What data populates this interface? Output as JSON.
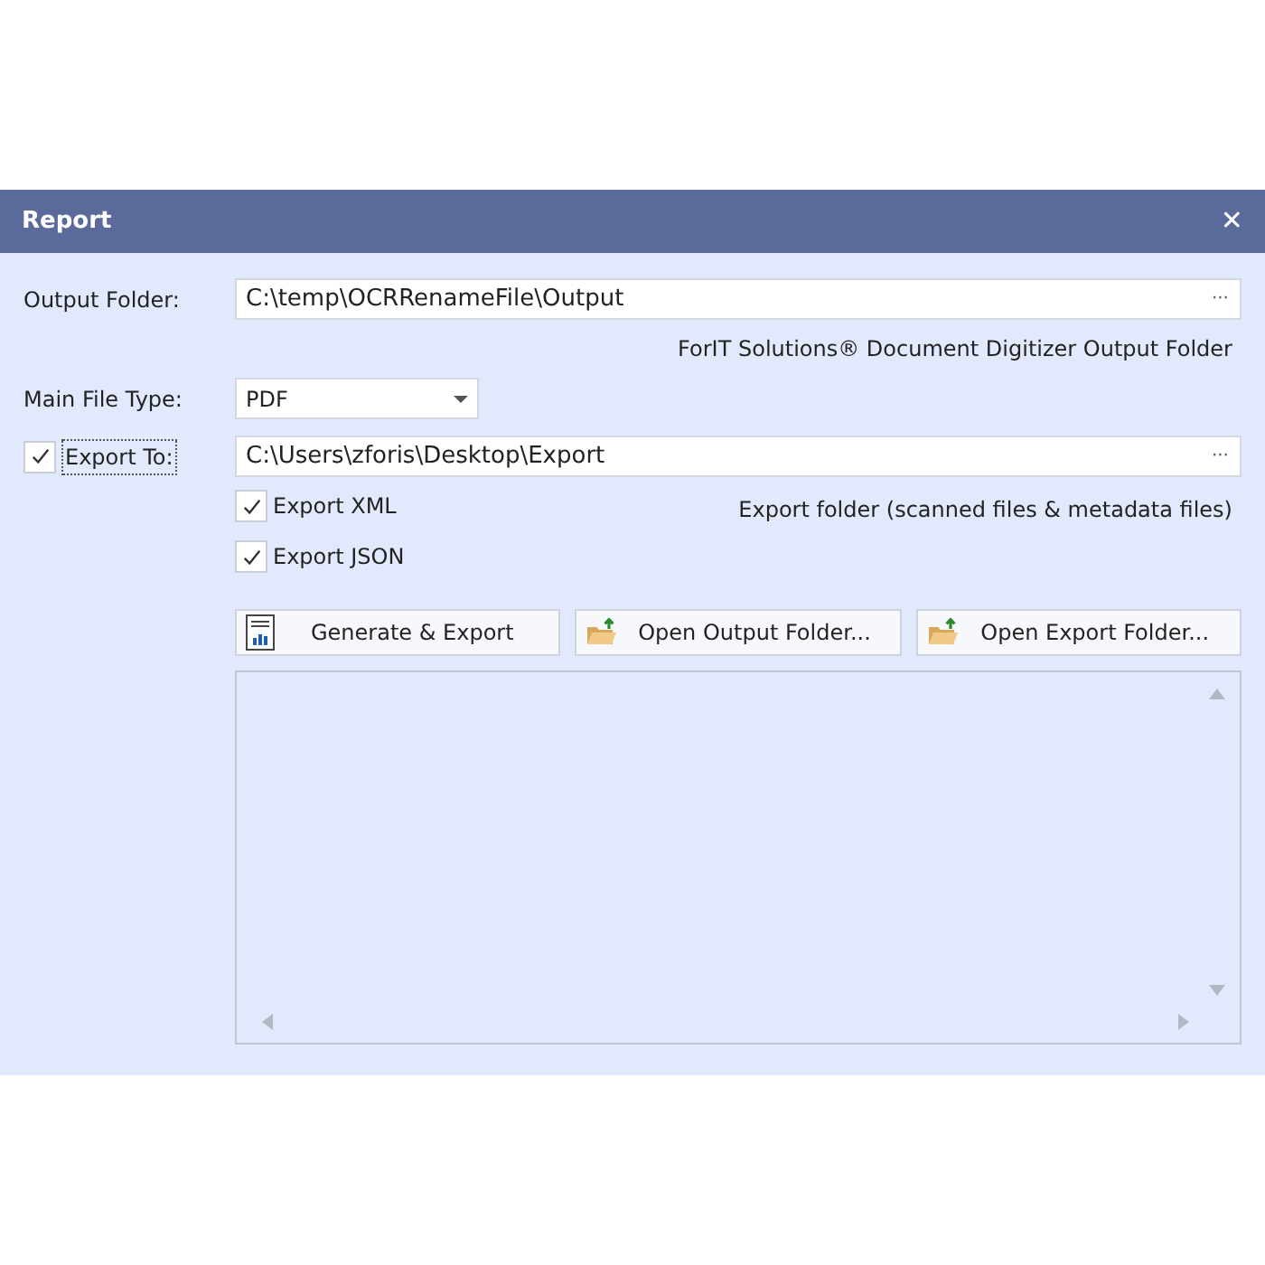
{
  "window": {
    "title": "Report",
    "close": "✕"
  },
  "output_folder": {
    "label": "Output Folder:",
    "value": "C:\\temp\\OCRRenameFile\\Output",
    "browse": "···",
    "hint": "ForIT Solutions® Document Digitizer Output Folder"
  },
  "main_file_type": {
    "label": "Main File Type:",
    "value": "PDF"
  },
  "export_to": {
    "label": "Export To:",
    "checked": true,
    "value": "C:\\Users\\zforis\\Desktop\\Export",
    "browse": "···",
    "hint": "Export folder (scanned files & metadata files)"
  },
  "options": [
    {
      "label": "Export XML",
      "checked": true
    },
    {
      "label": "Export JSON",
      "checked": true
    }
  ],
  "buttons": [
    {
      "label": "Generate & Export",
      "kind": "report"
    },
    {
      "label": "Open Output Folder...",
      "kind": "folder"
    },
    {
      "label": "Open Export Folder...",
      "kind": "folder"
    }
  ]
}
